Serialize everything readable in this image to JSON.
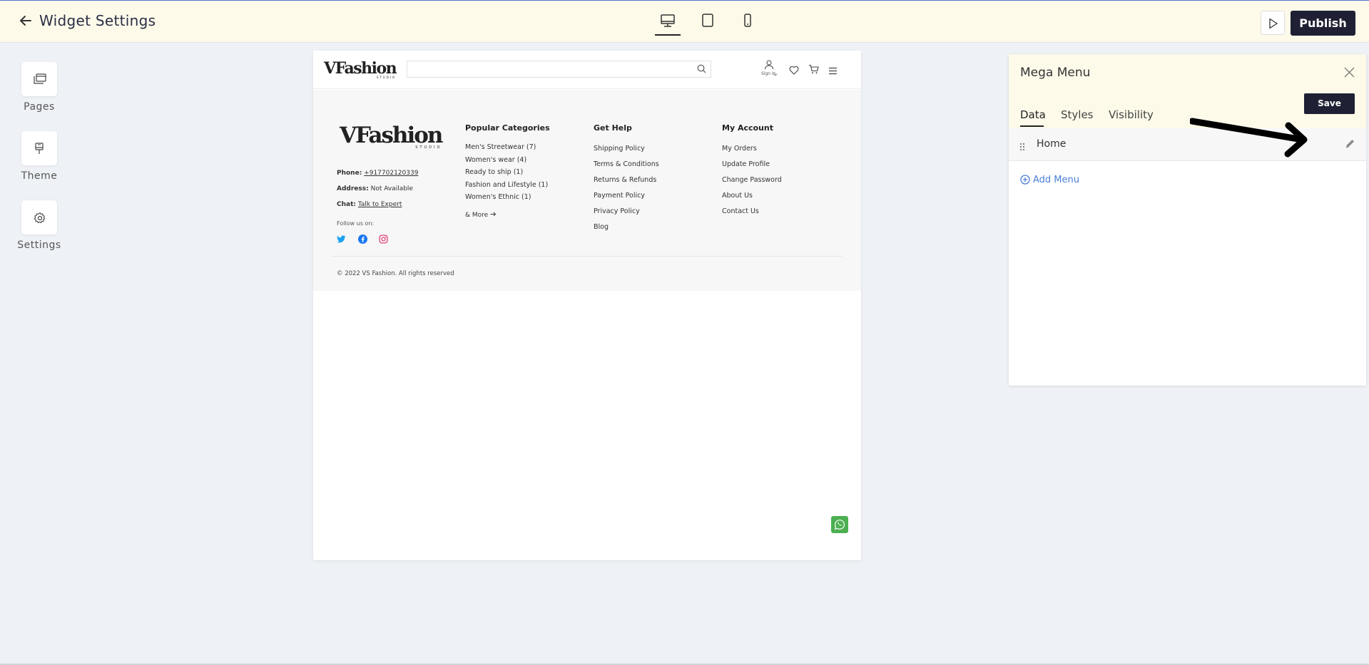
{
  "topbar": {
    "title": "Widget Settings",
    "publish_label": "Publish",
    "devices": [
      "desktop-icon",
      "tablet-icon",
      "mobile-icon"
    ],
    "active_device": "desktop"
  },
  "rail": [
    {
      "label": "Pages",
      "icon": "pages-icon"
    },
    {
      "label": "Theme",
      "icon": "theme-icon"
    },
    {
      "label": "Settings",
      "icon": "gear-icon"
    }
  ],
  "site": {
    "logo": "VFashion",
    "logo_sub": "STUDIO",
    "signin": "Sign In",
    "footer": {
      "phone_label": "Phone:",
      "phone": "+917702120339",
      "address_label": "Address:",
      "address": "Not Available",
      "chat_label": "Chat:",
      "chat": "Talk to Expert",
      "follow": "Follow us on:",
      "columns": [
        {
          "title": "Popular Categories",
          "links": [
            "Men's Streetwear (7)",
            "Women's wear (4)",
            "Ready to ship (1)",
            "Fashion and Lifestyle (1)",
            "Women's Ethnic (1)"
          ],
          "more": "& More"
        },
        {
          "title": "Get Help",
          "links": [
            "Shipping Policy",
            "Terms & Conditions",
            "Returns & Refunds",
            "Payment Policy",
            "Privacy Policy",
            "Blog"
          ]
        },
        {
          "title": "My Account",
          "links": [
            "My Orders",
            "Update Profile",
            "Change Password",
            "About Us",
            "Contact Us"
          ]
        }
      ],
      "copyright": "© 2022 VS Fashion. All rights reserved"
    }
  },
  "panel": {
    "title": "Mega Menu",
    "save_label": "Save",
    "tabs": [
      "Data",
      "Styles",
      "Visibility"
    ],
    "active_tab": "Data",
    "menu_items": [
      {
        "label": "Home"
      }
    ],
    "add_label": "Add Menu"
  },
  "colors": {
    "topbar_bg": "#fdfaea",
    "primary_button": "#1f2033",
    "link_blue": "#4a7fd4",
    "whatsapp": "#4caf50"
  }
}
